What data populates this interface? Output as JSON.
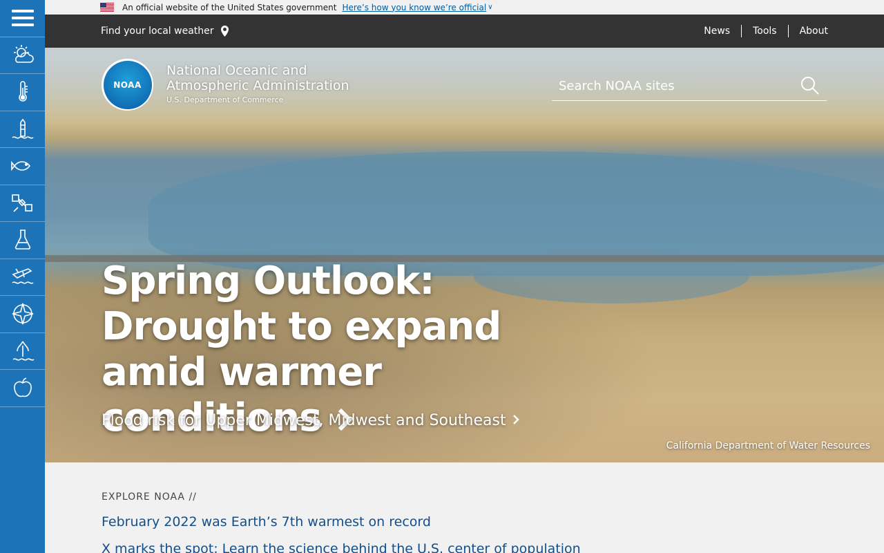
{
  "gov_banner": {
    "text": "An official website of the United States government",
    "link": "Here’s how you know we’re official"
  },
  "topnav": {
    "weather": "Find your local weather",
    "links": [
      "News",
      "Tools",
      "About"
    ]
  },
  "sidebar": {
    "items": [
      "menu-icon",
      "weather-icon",
      "climate-icon",
      "ocean-coasts-icon",
      "fisheries-icon",
      "satellites-icon",
      "research-icon",
      "marine-aviation-icon",
      "charting-icon",
      "sanctuaries-icon",
      "education-icon"
    ]
  },
  "header": {
    "logo_text": "NOAA",
    "org_line1": "National Oceanic and",
    "org_line2": "Atmospheric Administration",
    "dept": "U.S. Department of Commerce",
    "search_placeholder": "Search NOAA sites"
  },
  "hero": {
    "headline": "Spring Outlook: Drought to expand amid warmer conditions",
    "subhead": "Flood risk for Upper Midwest, Midwest and Southeast",
    "credit": "California Department of Water Resources"
  },
  "explore": {
    "label": "EXPLORE NOAA //",
    "links": [
      "February 2022 was Earth’s 7th warmest on record",
      "X marks the spot: Learn the science behind the U.S. center of population"
    ]
  },
  "colors": {
    "sidebar": "#1d73b8",
    "topnav": "#333333",
    "link": "#134e89"
  }
}
